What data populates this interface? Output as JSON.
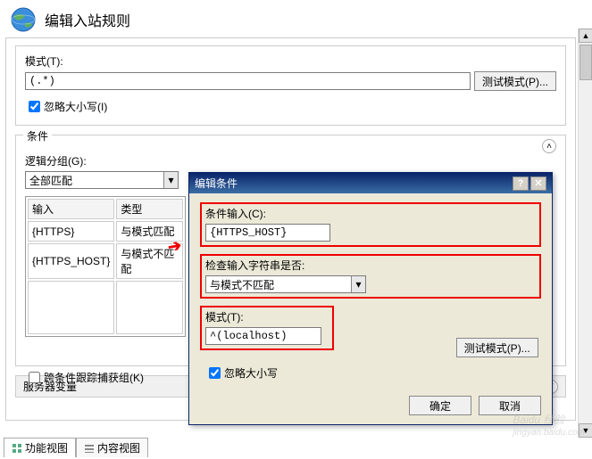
{
  "window": {
    "title": "编辑入站规则"
  },
  "pattern_box": {
    "legend": "模式(T):",
    "value": "(.*)",
    "test_btn": "测试模式(P)...",
    "ignore_case_label": "忽略大小写(I)",
    "ignore_case_checked": true
  },
  "conditions": {
    "legend": "条件",
    "group_label": "逻辑分组(G):",
    "group_value": "全部匹配",
    "table_headers": [
      "输入",
      "类型"
    ],
    "rows": [
      {
        "input": "{HTTPS}",
        "type": "与模式匹配"
      },
      {
        "input": "{HTTPS_HOST}",
        "type": "与模式不匹配"
      }
    ],
    "track_label": "跨条件跟踪捕获组(K)",
    "track_checked": false
  },
  "dialog": {
    "title": "编辑条件",
    "cond_input_label": "条件输入(C):",
    "cond_input_value": "{HTTPS_HOST}",
    "check_label": "检查输入字符串是否:",
    "check_value": "与模式不匹配",
    "pattern_label": "模式(T):",
    "pattern_value": "^(localhost)",
    "test_btn": "测试模式(P)...",
    "ignore_case_label": "忽略大小写",
    "ignore_case_checked": true,
    "ok": "确定",
    "cancel": "取消"
  },
  "server_vars": {
    "label": "服务器变量"
  },
  "tabs": {
    "func_view": "功能视图",
    "content_view": "内容视图"
  },
  "watermark": {
    "brand": "Baidu 经验",
    "url": "jingyan.baidu.com"
  }
}
